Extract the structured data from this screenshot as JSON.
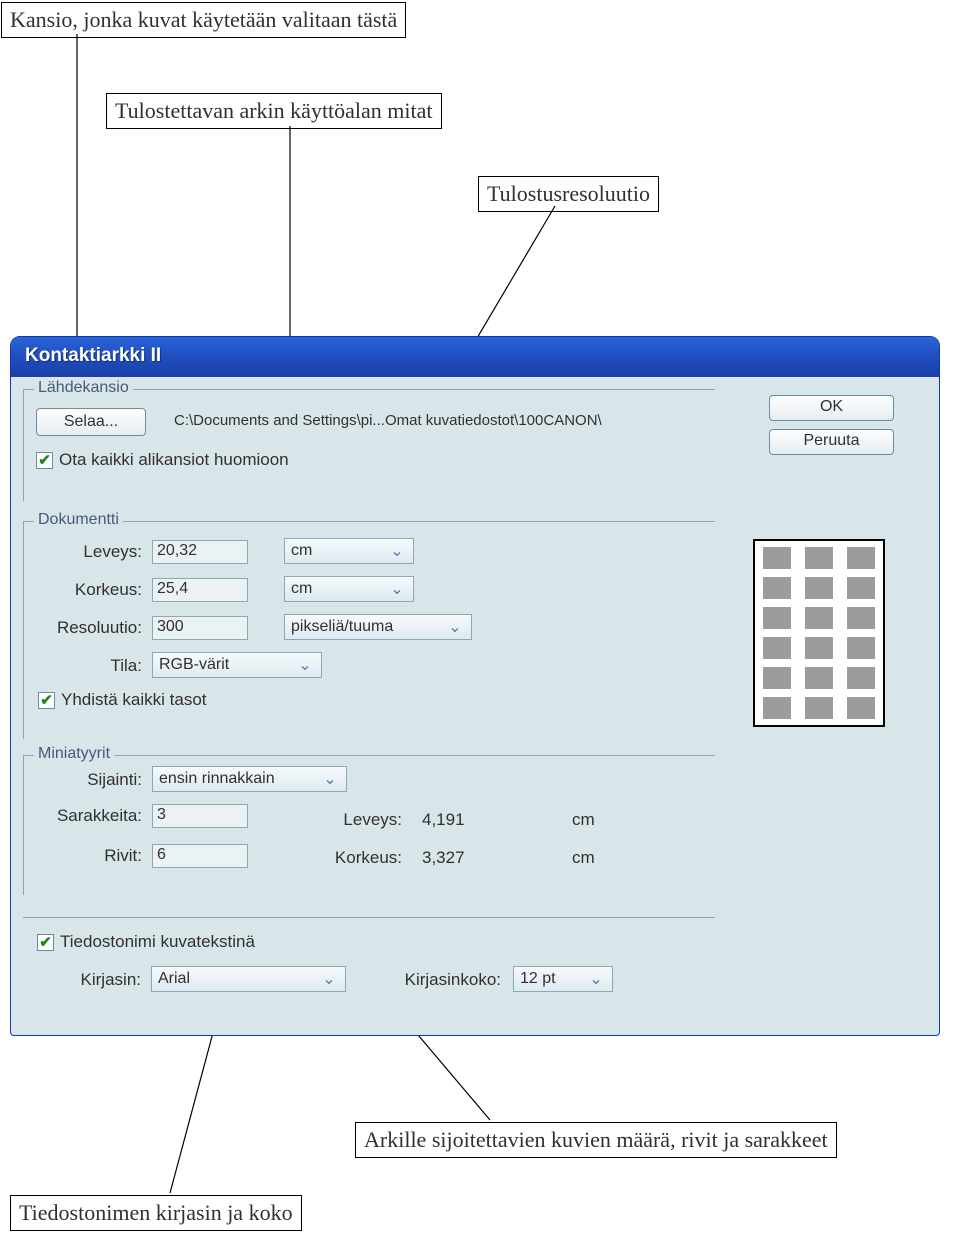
{
  "callouts": {
    "folder": "Kansio, jonka kuvat käytetään valitaan tästä",
    "sheet": "Tulostettavan arkin käyttöalan mitat",
    "resolution": "Tulostusresoluutio",
    "placement": "Arkille sijoitettavien kuvien määrä, rivit ja sarakkeet",
    "font": "Tiedostonimen kirjasin ja koko"
  },
  "dialog": {
    "title": "Kontaktiarkki II",
    "ok": "OK",
    "cancel": "Peruuta"
  },
  "source": {
    "legend": "Lähdekansio",
    "browse": "Selaa...",
    "path": "C:\\Documents and Settings\\pi...Omat kuvatiedostot\\100CANON\\",
    "subfolders": "Ota kaikki alikansiot huomioon"
  },
  "document": {
    "legend": "Dokumentti",
    "width_label": "Leveys:",
    "width_value": "20,32",
    "width_unit": "cm",
    "height_label": "Korkeus:",
    "height_value": "25,4",
    "height_unit": "cm",
    "res_label": "Resoluutio:",
    "res_value": "300",
    "res_unit": "pikseliä/tuuma",
    "mode_label": "Tila:",
    "mode_value": "RGB-värit",
    "flatten": "Yhdistä kaikki tasot"
  },
  "thumbs": {
    "legend": "Miniatyyrit",
    "place_label": "Sijainti:",
    "place_value": "ensin rinnakkain",
    "cols_label": "Sarakkeita:",
    "cols_value": "3",
    "rows_label": "Rivit:",
    "rows_value": "6",
    "w_label": "Leveys:",
    "w_value": "4,191",
    "w_unit": "cm",
    "h_label": "Korkeus:",
    "h_value": "3,327",
    "h_unit": "cm"
  },
  "caption": {
    "filename": "Tiedostonimi kuvatekstinä",
    "font_label": "Kirjasin:",
    "font_value": "Arial",
    "size_label": "Kirjasinkoko:",
    "size_value": "12 pt"
  }
}
